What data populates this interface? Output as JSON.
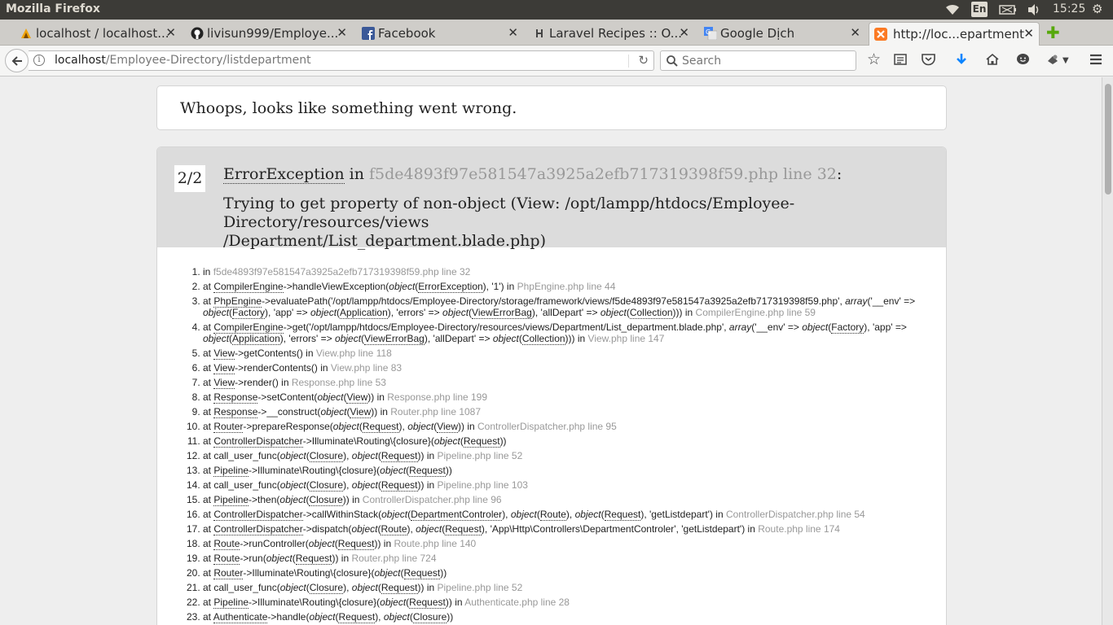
{
  "os": {
    "title": "Mozilla Firefox",
    "lang": "En",
    "clock": "15:25"
  },
  "tabs": [
    {
      "label": "localhost / localhost...",
      "icon": "phpmyadmin-icon"
    },
    {
      "label": "livisun999/Employe...",
      "icon": "github-icon"
    },
    {
      "label": "Facebook",
      "icon": "facebook-icon"
    },
    {
      "label": "Laravel Recipes :: O...",
      "icon": "laravel-icon"
    },
    {
      "label": "Google Dịch",
      "icon": "google-translate-icon"
    },
    {
      "label": "http://loc...epartment",
      "icon": "xampp-icon",
      "active": true
    }
  ],
  "nav": {
    "url_host": "localhost",
    "url_path": "/Employee-Directory/listdepartment",
    "search_placeholder": "Search"
  },
  "page": {
    "whoops": "Whoops, looks like something went wrong.",
    "count": "2/2",
    "exception_class": "ErrorException",
    "in_word": " in ",
    "exception_file": "f5de4893f97e581547a3925a2efb717319398f59.php line 32",
    "colon": ":",
    "message_line1": "Trying to get property of non-object (View: /opt/lampp/htdocs/Employee-Directory/resources/views",
    "message_line2": "/Department/List_department.blade.php)",
    "trace": [
      [
        [
          "t",
          "in "
        ],
        [
          "g",
          "f5de4893f97e581547a3925a2efb717319398f59.php line 32"
        ]
      ],
      [
        [
          "t",
          "at "
        ],
        [
          "a",
          "CompilerEngine"
        ],
        [
          "t",
          "->handleViewException("
        ],
        [
          "i",
          "object"
        ],
        [
          "t",
          "("
        ],
        [
          "a",
          "ErrorException"
        ],
        [
          "t",
          "), '1') in "
        ],
        [
          "g",
          "PhpEngine.php line 44"
        ]
      ],
      [
        [
          "t",
          "at "
        ],
        [
          "a",
          "PhpEngine"
        ],
        [
          "t",
          "->evaluatePath('/opt/lampp/htdocs/Employee-Directory/storage/framework/views/f5de4893f97e581547a3925a2efb717319398f59.php', "
        ],
        [
          "i",
          "array"
        ],
        [
          "t",
          "('__env' => "
        ],
        [
          "i",
          "object"
        ],
        [
          "t",
          "("
        ],
        [
          "a",
          "Factory"
        ],
        [
          "t",
          "), 'app' => "
        ],
        [
          "i",
          "object"
        ],
        [
          "t",
          "("
        ],
        [
          "a",
          "Application"
        ],
        [
          "t",
          "), 'errors' => "
        ],
        [
          "i",
          "object"
        ],
        [
          "t",
          "("
        ],
        [
          "a",
          "ViewErrorBag"
        ],
        [
          "t",
          "), 'allDepart' => "
        ],
        [
          "i",
          "object"
        ],
        [
          "t",
          "("
        ],
        [
          "a",
          "Collection"
        ],
        [
          "t",
          "))) in "
        ],
        [
          "g",
          "CompilerEngine.php line 59"
        ]
      ],
      [
        [
          "t",
          "at "
        ],
        [
          "a",
          "CompilerEngine"
        ],
        [
          "t",
          "->get('/opt/lampp/htdocs/Employee-Directory/resources/views/Department/List_department.blade.php', "
        ],
        [
          "i",
          "array"
        ],
        [
          "t",
          "('__env' => "
        ],
        [
          "i",
          "object"
        ],
        [
          "t",
          "("
        ],
        [
          "a",
          "Factory"
        ],
        [
          "t",
          "), 'app' => "
        ],
        [
          "i",
          "object"
        ],
        [
          "t",
          "("
        ],
        [
          "a",
          "Application"
        ],
        [
          "t",
          "), 'errors' => "
        ],
        [
          "i",
          "object"
        ],
        [
          "t",
          "("
        ],
        [
          "a",
          "ViewErrorBag"
        ],
        [
          "t",
          "), 'allDepart' => "
        ],
        [
          "i",
          "object"
        ],
        [
          "t",
          "("
        ],
        [
          "a",
          "Collection"
        ],
        [
          "t",
          "))) in "
        ],
        [
          "g",
          "View.php line 147"
        ]
      ],
      [
        [
          "t",
          "at "
        ],
        [
          "a",
          "View"
        ],
        [
          "t",
          "->getContents() in "
        ],
        [
          "g",
          "View.php line 118"
        ]
      ],
      [
        [
          "t",
          "at "
        ],
        [
          "a",
          "View"
        ],
        [
          "t",
          "->renderContents() in "
        ],
        [
          "g",
          "View.php line 83"
        ]
      ],
      [
        [
          "t",
          "at "
        ],
        [
          "a",
          "View"
        ],
        [
          "t",
          "->render() in "
        ],
        [
          "g",
          "Response.php line 53"
        ]
      ],
      [
        [
          "t",
          "at "
        ],
        [
          "a",
          "Response"
        ],
        [
          "t",
          "->setContent("
        ],
        [
          "i",
          "object"
        ],
        [
          "t",
          "("
        ],
        [
          "a",
          "View"
        ],
        [
          "t",
          ")) in "
        ],
        [
          "g",
          "Response.php line 199"
        ]
      ],
      [
        [
          "t",
          "at "
        ],
        [
          "a",
          "Response"
        ],
        [
          "t",
          "->__construct("
        ],
        [
          "i",
          "object"
        ],
        [
          "t",
          "("
        ],
        [
          "a",
          "View"
        ],
        [
          "t",
          ")) in "
        ],
        [
          "g",
          "Router.php line 1087"
        ]
      ],
      [
        [
          "t",
          "at "
        ],
        [
          "a",
          "Router"
        ],
        [
          "t",
          "->prepareResponse("
        ],
        [
          "i",
          "object"
        ],
        [
          "t",
          "("
        ],
        [
          "a",
          "Request"
        ],
        [
          "t",
          "), "
        ],
        [
          "i",
          "object"
        ],
        [
          "t",
          "("
        ],
        [
          "a",
          "View"
        ],
        [
          "t",
          ")) in "
        ],
        [
          "g",
          "ControllerDispatcher.php line 95"
        ]
      ],
      [
        [
          "t",
          "at "
        ],
        [
          "a",
          "ControllerDispatcher"
        ],
        [
          "t",
          "->Illuminate\\Routing\\{closure}("
        ],
        [
          "i",
          "object"
        ],
        [
          "t",
          "("
        ],
        [
          "a",
          "Request"
        ],
        [
          "t",
          "))"
        ]
      ],
      [
        [
          "t",
          "at call_user_func("
        ],
        [
          "i",
          "object"
        ],
        [
          "t",
          "("
        ],
        [
          "a",
          "Closure"
        ],
        [
          "t",
          "), "
        ],
        [
          "i",
          "object"
        ],
        [
          "t",
          "("
        ],
        [
          "a",
          "Request"
        ],
        [
          "t",
          ")) in "
        ],
        [
          "g",
          "Pipeline.php line 52"
        ]
      ],
      [
        [
          "t",
          "at "
        ],
        [
          "a",
          "Pipeline"
        ],
        [
          "t",
          "->Illuminate\\Routing\\{closure}("
        ],
        [
          "i",
          "object"
        ],
        [
          "t",
          "("
        ],
        [
          "a",
          "Request"
        ],
        [
          "t",
          "))"
        ]
      ],
      [
        [
          "t",
          "at call_user_func("
        ],
        [
          "i",
          "object"
        ],
        [
          "t",
          "("
        ],
        [
          "a",
          "Closure"
        ],
        [
          "t",
          "), "
        ],
        [
          "i",
          "object"
        ],
        [
          "t",
          "("
        ],
        [
          "a",
          "Request"
        ],
        [
          "t",
          ")) in "
        ],
        [
          "g",
          "Pipeline.php line 103"
        ]
      ],
      [
        [
          "t",
          "at "
        ],
        [
          "a",
          "Pipeline"
        ],
        [
          "t",
          "->then("
        ],
        [
          "i",
          "object"
        ],
        [
          "t",
          "("
        ],
        [
          "a",
          "Closure"
        ],
        [
          "t",
          ")) in "
        ],
        [
          "g",
          "ControllerDispatcher.php line 96"
        ]
      ],
      [
        [
          "t",
          "at "
        ],
        [
          "a",
          "ControllerDispatcher"
        ],
        [
          "t",
          "->callWithinStack("
        ],
        [
          "i",
          "object"
        ],
        [
          "t",
          "("
        ],
        [
          "a",
          "DepartmentControler"
        ],
        [
          "t",
          "), "
        ],
        [
          "i",
          "object"
        ],
        [
          "t",
          "("
        ],
        [
          "a",
          "Route"
        ],
        [
          "t",
          "), "
        ],
        [
          "i",
          "object"
        ],
        [
          "t",
          "("
        ],
        [
          "a",
          "Request"
        ],
        [
          "t",
          "), 'getListdepart') in "
        ],
        [
          "g",
          "ControllerDispatcher.php line 54"
        ]
      ],
      [
        [
          "t",
          "at "
        ],
        [
          "a",
          "ControllerDispatcher"
        ],
        [
          "t",
          "->dispatch("
        ],
        [
          "i",
          "object"
        ],
        [
          "t",
          "("
        ],
        [
          "a",
          "Route"
        ],
        [
          "t",
          "), "
        ],
        [
          "i",
          "object"
        ],
        [
          "t",
          "("
        ],
        [
          "a",
          "Request"
        ],
        [
          "t",
          "), 'App\\Http\\Controllers\\DepartmentControler', 'getListdepart') in "
        ],
        [
          "g",
          "Route.php line 174"
        ]
      ],
      [
        [
          "t",
          "at "
        ],
        [
          "a",
          "Route"
        ],
        [
          "t",
          "->runController("
        ],
        [
          "i",
          "object"
        ],
        [
          "t",
          "("
        ],
        [
          "a",
          "Request"
        ],
        [
          "t",
          ")) in "
        ],
        [
          "g",
          "Route.php line 140"
        ]
      ],
      [
        [
          "t",
          "at "
        ],
        [
          "a",
          "Route"
        ],
        [
          "t",
          "->run("
        ],
        [
          "i",
          "object"
        ],
        [
          "t",
          "("
        ],
        [
          "a",
          "Request"
        ],
        [
          "t",
          ")) in "
        ],
        [
          "g",
          "Router.php line 724"
        ]
      ],
      [
        [
          "t",
          "at "
        ],
        [
          "a",
          "Router"
        ],
        [
          "t",
          "->Illuminate\\Routing\\{closure}("
        ],
        [
          "i",
          "object"
        ],
        [
          "t",
          "("
        ],
        [
          "a",
          "Request"
        ],
        [
          "t",
          "))"
        ]
      ],
      [
        [
          "t",
          "at call_user_func("
        ],
        [
          "i",
          "object"
        ],
        [
          "t",
          "("
        ],
        [
          "a",
          "Closure"
        ],
        [
          "t",
          "), "
        ],
        [
          "i",
          "object"
        ],
        [
          "t",
          "("
        ],
        [
          "a",
          "Request"
        ],
        [
          "t",
          ")) in "
        ],
        [
          "g",
          "Pipeline.php line 52"
        ]
      ],
      [
        [
          "t",
          "at "
        ],
        [
          "a",
          "Pipeline"
        ],
        [
          "t",
          "->Illuminate\\Routing\\{closure}("
        ],
        [
          "i",
          "object"
        ],
        [
          "t",
          "("
        ],
        [
          "a",
          "Request"
        ],
        [
          "t",
          ")) in "
        ],
        [
          "g",
          "Authenticate.php line 28"
        ]
      ],
      [
        [
          "t",
          "at "
        ],
        [
          "a",
          "Authenticate"
        ],
        [
          "t",
          "->handle("
        ],
        [
          "i",
          "object"
        ],
        [
          "t",
          "("
        ],
        [
          "a",
          "Request"
        ],
        [
          "t",
          "), "
        ],
        [
          "i",
          "object"
        ],
        [
          "t",
          "("
        ],
        [
          "a",
          "Closure"
        ],
        [
          "t",
          "))"
        ]
      ]
    ]
  },
  "colors": {
    "os_bar": "#3c3b37",
    "tab_bar": "#cfcdc9",
    "header_gray": "#dcdcdc",
    "muted_text": "#999999"
  }
}
